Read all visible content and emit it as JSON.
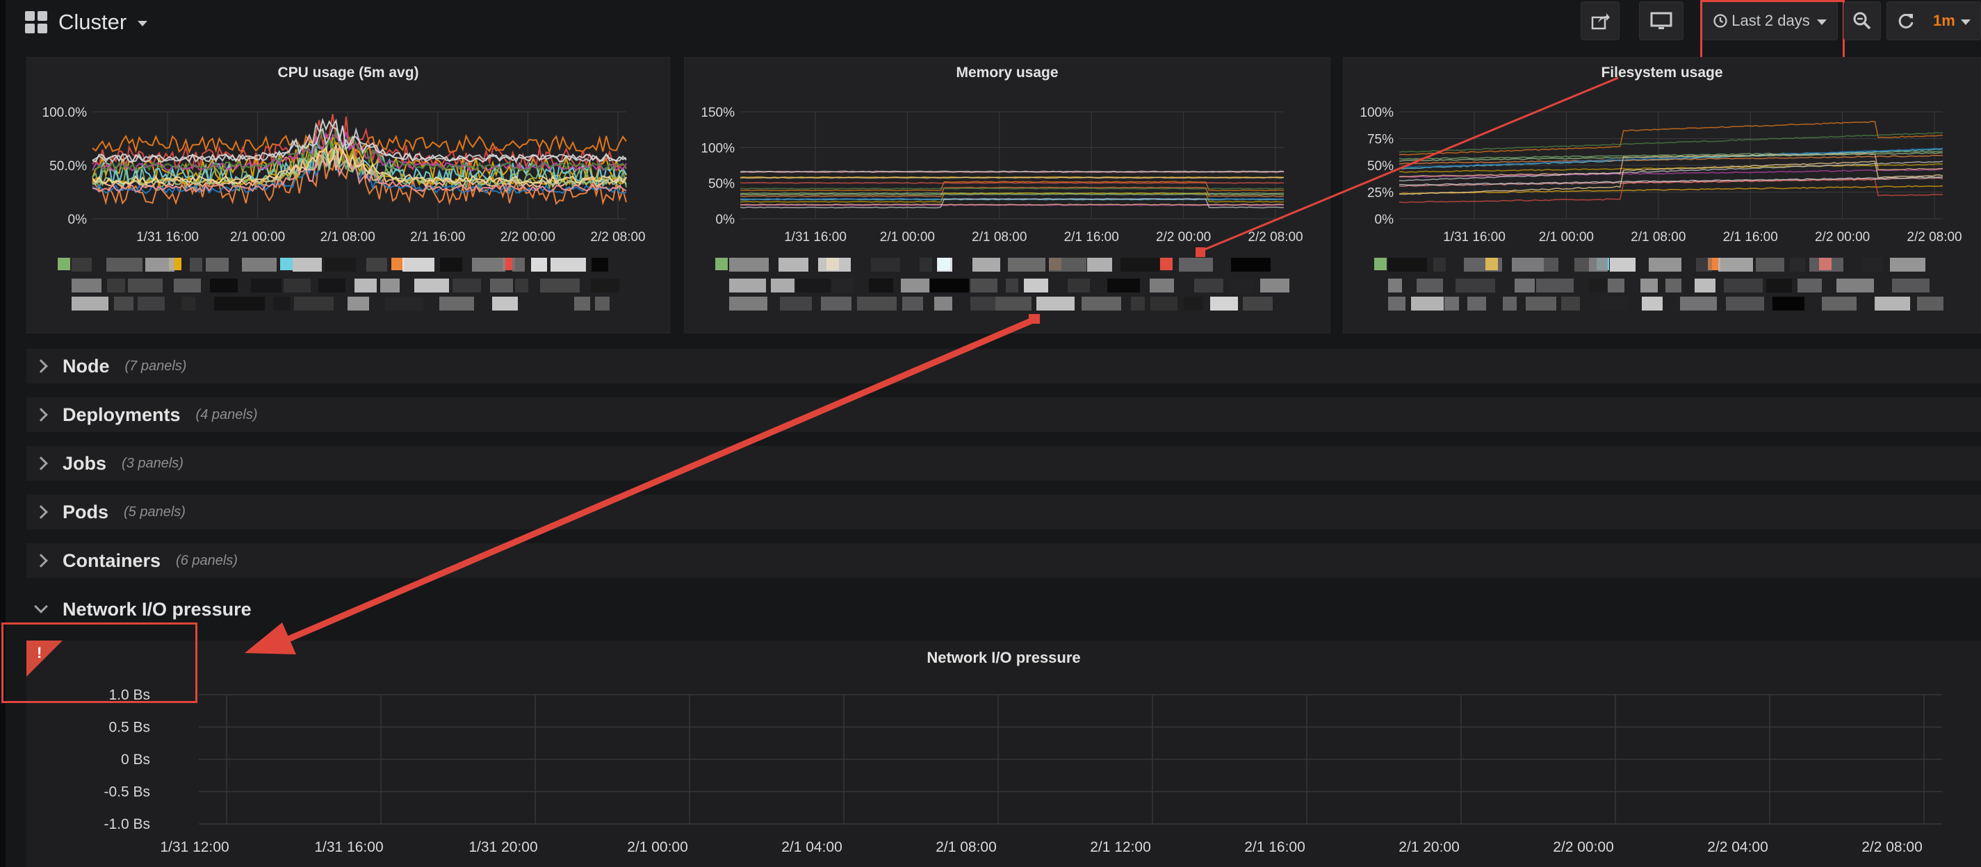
{
  "header": {
    "title": "Cluster",
    "time_range": "Last 2 days",
    "refresh_interval": "1m"
  },
  "panels": [
    {
      "title": "CPU usage (5m avg)",
      "y_ticks": [
        "100.0%",
        "50.0%",
        "0%"
      ],
      "x_ticks": [
        "1/31 16:00",
        "2/1 00:00",
        "2/1 08:00",
        "2/1 16:00",
        "2/2 00:00",
        "2/2 08:00"
      ]
    },
    {
      "title": "Memory usage",
      "y_ticks": [
        "150%",
        "100%",
        "50%",
        "0%"
      ],
      "x_ticks": [
        "1/31 16:00",
        "2/1 00:00",
        "2/1 08:00",
        "2/1 16:00",
        "2/2 00:00",
        "2/2 08:00"
      ]
    },
    {
      "title": "Filesystem usage",
      "y_ticks": [
        "100%",
        "75%",
        "50%",
        "25%",
        "0%"
      ],
      "x_ticks": [
        "1/31 16:00",
        "2/1 00:00",
        "2/1 08:00",
        "2/1 16:00",
        "2/2 00:00",
        "2/2 08:00"
      ]
    }
  ],
  "rows": [
    {
      "name": "Node",
      "count": "(7 panels)"
    },
    {
      "name": "Deployments",
      "count": "(4 panels)"
    },
    {
      "name": "Jobs",
      "count": "(3 panels)"
    },
    {
      "name": "Pods",
      "count": "(5 panels)"
    },
    {
      "name": "Containers",
      "count": "(6 panels)"
    }
  ],
  "open_row": {
    "name": "Network I/O pressure"
  },
  "network_panel": {
    "title": "Network I/O pressure",
    "alert_glyph": "!",
    "y_ticks": [
      "1.0 Bs",
      "0.5 Bs",
      "0 Bs",
      "-0.5 Bs",
      "-1.0 Bs"
    ],
    "x_ticks": [
      "1/31 12:00",
      "1/31 16:00",
      "1/31 20:00",
      "2/1 00:00",
      "2/1 04:00",
      "2/1 08:00",
      "2/1 12:00",
      "2/1 16:00",
      "2/1 20:00",
      "2/2 00:00",
      "2/2 04:00",
      "2/2 08:00"
    ]
  },
  "colors": {
    "accent": "#eb7b18",
    "annotation": "#e0453b",
    "background": "#161719",
    "panel": "#212124"
  }
}
